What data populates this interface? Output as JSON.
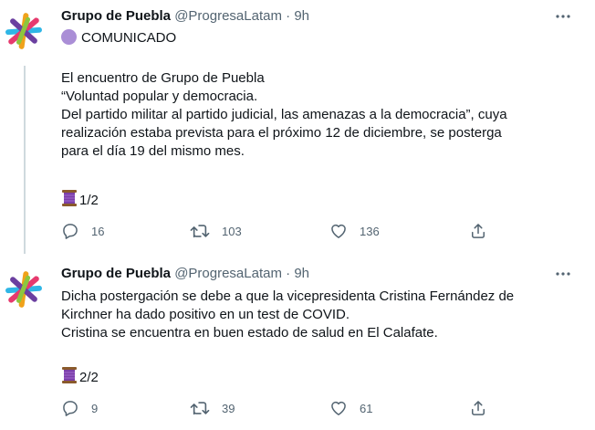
{
  "tweets": [
    {
      "author": "Grupo de Puebla",
      "handle": "@ProgresaLatam",
      "separator": "·",
      "time": "9h",
      "lines": [
        "COMUNICADO",
        "",
        "El encuentro de Grupo de Puebla",
        "“Voluntad popular y democracia.",
        "Del partido militar al partido judicial, las amenazas a la democracia”, cuya",
        "realización estaba prevista para el próximo 12 de diciembre, se posterga",
        "para el día 19 del mismo mes."
      ],
      "thread_counter": "1/2",
      "replies": "16",
      "retweets": "103",
      "likes": "136"
    },
    {
      "author": "Grupo de Puebla",
      "handle": "@ProgresaLatam",
      "separator": "·",
      "time": "9h",
      "lines": [
        "Dicha postergación se debe a que la vicepresidenta Cristina Fernández de",
        "Kirchner ha dado positivo en un test de COVID.",
        "Cristina se encuentra en buen estado de salud en El Calafate."
      ],
      "thread_counter": "2/2",
      "replies": "9",
      "retweets": "39",
      "likes": "61"
    }
  ],
  "icons": {
    "avatar": "grupo-de-puebla-logo",
    "status_emoji": "purple-circle",
    "thread_emoji": "spool-of-thread",
    "reply": "reply-icon",
    "retweet": "retweet-icon",
    "like": "like-icon",
    "share": "share-icon",
    "more": "more-icon"
  },
  "colors": {
    "text": "#0f1419",
    "secondary": "#536471",
    "thread_line": "#cfd9de",
    "divider": "#eff3f4",
    "purple_circle": "#aa8ed6"
  }
}
